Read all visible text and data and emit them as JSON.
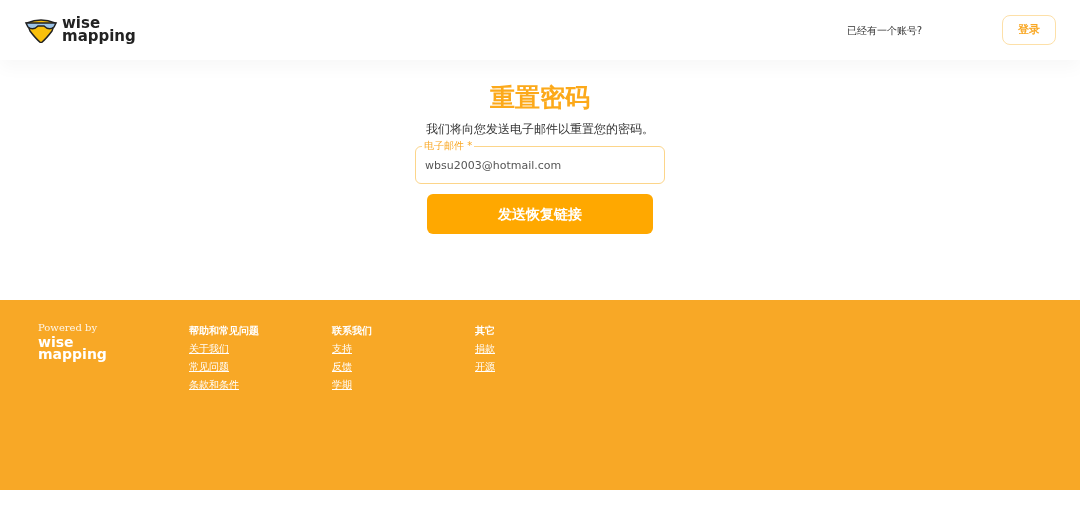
{
  "header": {
    "logo": {
      "line_1": "wise",
      "line_2": "mapping"
    },
    "account_prompt": "已经有一个账号?",
    "login_button": "登录"
  },
  "form": {
    "title": "重置密码",
    "description": "我们将向您发送电子邮件以重置您的密码。",
    "email_field": {
      "label": "电子邮件 *",
      "value": "wbsu2003@hotmail.com"
    },
    "submit_button": "发送恢复链接"
  },
  "footer": {
    "powered_by": "Powered by",
    "logo": {
      "line_1": "wise",
      "line_2": "mapping"
    },
    "columns": [
      {
        "heading": "帮助和常见问题",
        "links": [
          "关于我们",
          "常见问题",
          "条款和条件"
        ]
      },
      {
        "heading": "联系我们",
        "links": [
          "支持",
          "反馈",
          "学期"
        ]
      },
      {
        "heading": "其它",
        "links": [
          "捐款",
          "开源"
        ]
      }
    ]
  }
}
